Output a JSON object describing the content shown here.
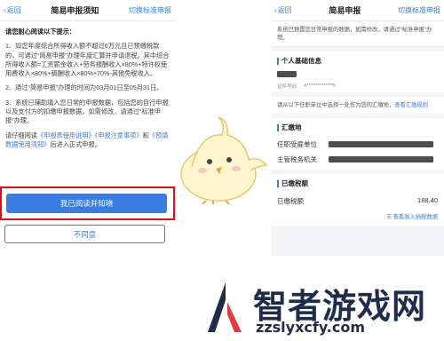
{
  "left": {
    "nav": {
      "back": "返回",
      "title": "简易申报须知",
      "switch": "切换标准申报"
    },
    "head": "请您耐心阅读以下提示：",
    "p1": "1、如您年度综合所得收入额不超过6万元且已预缴税款的，可通过“简易申报”办理年度汇算并申请退税。其中综合所得收入额=工资薪金收入+劳务报酬收入×80%+特许权使用费收入×80%+稿酬收入×80%×70%-其他免税收入。",
    "p2": "2、通过“简易申报”办理的时间为03月01日至05月31日。",
    "p3": "3、系统已辅助填入您日常的申报数据，包括您的自行申报以及支付方的扣缴申报数据，如需修改，请通过“标准申报”办理。",
    "p4a": "请仔细阅读",
    "p4link1": "《申报表使用说明》",
    "p4link2": "《申报注意事项》",
    "p4and": "和",
    "p4link3": "《预填数据使用须知》",
    "p4b": "后进入正式申报。",
    "btn_ok": "我已阅读并知晓",
    "btn_no": "不同意"
  },
  "right": {
    "nav": {
      "back": "返回",
      "title": "简易申报",
      "switch": "切换标准申报"
    },
    "notice": "系统已预置您日常申报的数据，如需修改，请通过“标准申报”办理。",
    "sec_personal": "个人基础信息",
    "id_label": "证件号码",
    "id_value": "4**************5",
    "tip": "请从以下任职单位中选择一处作为您的汇缴地，",
    "tip_link": "查看汇缴规则",
    "sec_place": "汇缴地",
    "employer_label": "任职受雇单位",
    "tax_office_label": "主管税务机关",
    "sec_paid": "已缴税额",
    "paid_label": "已缴税额",
    "paid_value": "188.40",
    "view_link": "查看收入纳税数据"
  },
  "watermark": {
    "brand": "智者游戏网",
    "url": "zzslyxcfy.com"
  },
  "colors": {
    "accent": "#3a7de0",
    "highlight": "#e01010"
  }
}
